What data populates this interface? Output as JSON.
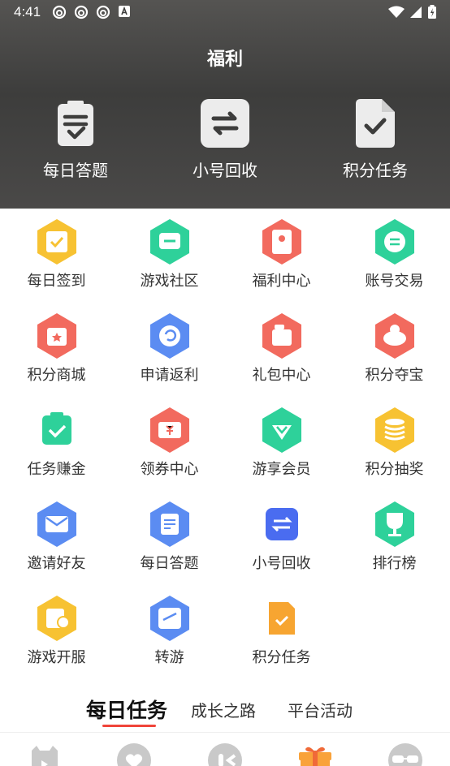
{
  "status": {
    "time": "4:41"
  },
  "header": {
    "title": "福利"
  },
  "quick_actions": [
    {
      "label": "每日答题",
      "icon": "clipboard-check-icon"
    },
    {
      "label": "小号回收",
      "icon": "swap-arrows-icon"
    },
    {
      "label": "积分任务",
      "icon": "document-check-icon"
    }
  ],
  "grid": [
    {
      "label": "每日签到",
      "icon": "calendar-check-icon",
      "color": "#f7c232"
    },
    {
      "label": "游戏社区",
      "icon": "chat-icon",
      "color": "#2ed19a"
    },
    {
      "label": "福利中心",
      "icon": "red-envelope-icon",
      "color": "#f26a5e"
    },
    {
      "label": "账号交易",
      "icon": "exchange-icon",
      "color": "#2ed19a"
    },
    {
      "label": "积分商城",
      "icon": "shopping-bag-icon",
      "color": "#f26a5e"
    },
    {
      "label": "申请返利",
      "icon": "refund-icon",
      "color": "#5b8cf2"
    },
    {
      "label": "礼包中心",
      "icon": "gift-box-icon",
      "color": "#f26a5e"
    },
    {
      "label": "积分夺宝",
      "icon": "treasure-icon",
      "color": "#f26a5e"
    },
    {
      "label": "任务赚金",
      "icon": "task-check-icon",
      "color": "#2ed19a"
    },
    {
      "label": "领券中心",
      "icon": "coupon-icon",
      "color": "#f26a5e"
    },
    {
      "label": "游享会员",
      "icon": "diamond-icon",
      "color": "#2ed19a"
    },
    {
      "label": "积分抽奖",
      "icon": "coin-stack-icon",
      "color": "#f7c232"
    },
    {
      "label": "邀请好友",
      "icon": "invite-mail-icon",
      "color": "#5b8cf2"
    },
    {
      "label": "每日答题",
      "icon": "clipboard-icon",
      "color": "#5b8cf2"
    },
    {
      "label": "小号回收",
      "icon": "swap-icon",
      "color": "#4a6cf0"
    },
    {
      "label": "排行榜",
      "icon": "trophy-icon",
      "color": "#2ed19a"
    },
    {
      "label": "游戏开服",
      "icon": "server-clock-icon",
      "color": "#f7c232"
    },
    {
      "label": "转游",
      "icon": "transfer-icon",
      "color": "#5b8cf2"
    },
    {
      "label": "积分任务",
      "icon": "doc-check-icon",
      "color": "#f7a531"
    }
  ],
  "tabs": [
    {
      "label": "每日任务",
      "active": true
    },
    {
      "label": "成长之路",
      "active": false
    },
    {
      "label": "平台活动",
      "active": false
    }
  ],
  "bottom_nav": [
    {
      "icon": "game-icon"
    },
    {
      "icon": "heart-icon"
    },
    {
      "icon": "community-icon"
    },
    {
      "icon": "gift-icon"
    },
    {
      "icon": "profile-glasses-icon"
    }
  ]
}
